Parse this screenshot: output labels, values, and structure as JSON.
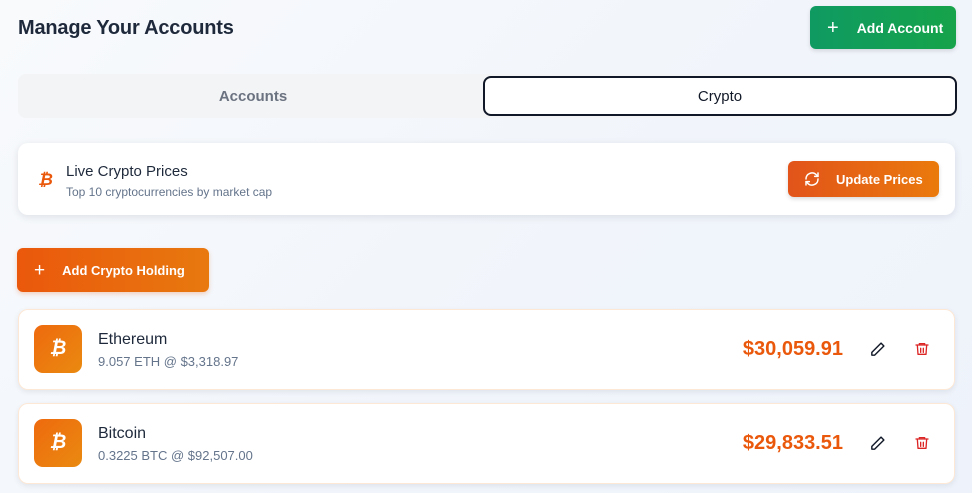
{
  "header": {
    "title": "Manage Your Accounts",
    "add_account_label": "Add Account"
  },
  "tabs": [
    {
      "label": "Accounts",
      "active": false
    },
    {
      "label": "Crypto",
      "active": true
    }
  ],
  "prices_card": {
    "title": "Live Crypto Prices",
    "subtitle": "Top 10 cryptocurrencies by market cap",
    "update_label": "Update Prices"
  },
  "add_crypto_label": "Add Crypto Holding",
  "holdings": [
    {
      "name": "Ethereum",
      "detail": "9.057 ETH @ $3,318.97",
      "value": "$30,059.91"
    },
    {
      "name": "Bitcoin",
      "detail": "0.3225 BTC @ $92,507.00",
      "value": "$29,833.51"
    }
  ],
  "icons": {
    "coin_symbol": "₿",
    "plus": "+"
  },
  "colors": {
    "accent_orange": "#ea580c",
    "accent_green": "#16a34a",
    "delete_red": "#dc2626"
  }
}
